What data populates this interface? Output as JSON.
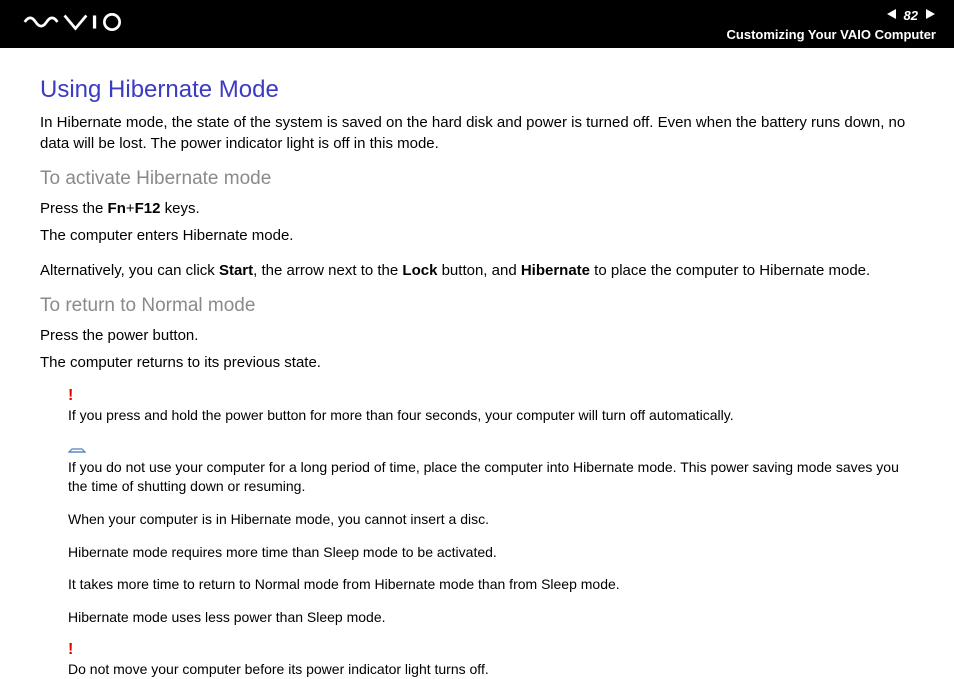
{
  "header": {
    "pageNumber": "82",
    "sectionTitle": "Customizing Your VAIO Computer"
  },
  "content": {
    "heading": "Using Hibernate Mode",
    "intro": "In Hibernate mode, the state of the system is saved on the hard disk and power is turned off. Even when the battery runs down, no data will be lost. The power indicator light is off in this mode.",
    "activate": {
      "heading": "To activate Hibernate mode",
      "line1a": "Press the ",
      "line1b_bold": "Fn",
      "line1c": "+",
      "line1d_bold": "F12",
      "line1e": " keys.",
      "line2": "The computer enters Hibernate mode.",
      "line3a": "Alternatively, you can click ",
      "line3b_bold": "Start",
      "line3c": ", the arrow next to the ",
      "line3d_bold": "Lock",
      "line3e": " button, and ",
      "line3f_bold": "Hibernate",
      "line3g": " to place the computer to Hibernate mode."
    },
    "return": {
      "heading": "To return to Normal mode",
      "line1": "Press the power button.",
      "line2": "The computer returns to its previous state."
    },
    "notes": {
      "warning1": "If you press and hold the power button for more than four seconds, your computer will turn off automatically.",
      "info1": "If you do not use your computer for a long period of time, place the computer into Hibernate mode. This power saving mode saves you the time of shutting down or resuming.",
      "info2": "When your computer is in Hibernate mode, you cannot insert a disc.",
      "info3": "Hibernate mode requires more time than Sleep mode to be activated.",
      "info4": "It takes more time to return to Normal mode from Hibernate mode than from Sleep mode.",
      "info5": "Hibernate mode uses less power than Sleep mode.",
      "warning2": "Do not move your computer before its power indicator light turns off."
    }
  }
}
